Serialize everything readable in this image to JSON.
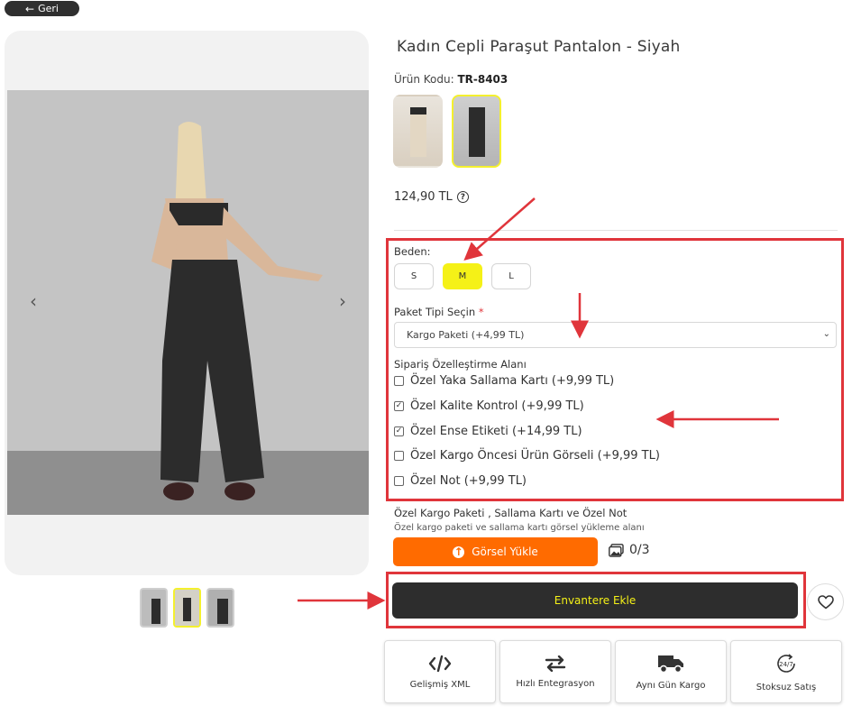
{
  "nav": {
    "back_label": "Geri"
  },
  "product": {
    "title": "Kadın Cepli Paraşut Pantalon - Siyah",
    "code_label": "Ürün Kodu:",
    "code_value": "TR-8403",
    "price": "124,90 TL"
  },
  "size": {
    "label": "Beden:",
    "options": [
      "S",
      "M",
      "L"
    ],
    "selected": "M"
  },
  "package": {
    "label": "Paket Tipi Seçin",
    "required_mark": "*",
    "selected": "Kargo Paketi (+4,99 TL)"
  },
  "customization": {
    "label": "Sipariş Özelleştirme Alanı",
    "options": [
      {
        "label": "Özel Yaka Sallama Kartı (+9,99 TL)",
        "checked": false
      },
      {
        "label": "Özel Kalite Kontrol (+9,99 TL)",
        "checked": true
      },
      {
        "label": "Özel Ense Etiketi (+14,99 TL)",
        "checked": true
      },
      {
        "label": "Özel Kargo Öncesi Ürün Görseli (+9,99 TL)",
        "checked": false
      },
      {
        "label": "Özel Not (+9,99 TL)",
        "checked": false
      }
    ]
  },
  "upload": {
    "title": "Özel Kargo Paketi , Sallama Kartı ve Özel Not",
    "subtitle": "Özel kargo paketi ve sallama kartı görsel yükleme alanı",
    "button_label": "Görsel Yükle",
    "count": "0/3"
  },
  "cart": {
    "button_label": "Envantere Ekle"
  },
  "features": [
    {
      "label": "Gelişmiş XML",
      "icon": "code-icon"
    },
    {
      "label": "Hızlı Entegrasyon",
      "icon": "swap-arrows-icon"
    },
    {
      "label": "Aynı Gün Kargo",
      "icon": "truck-icon"
    },
    {
      "label": "Stoksuz Satış",
      "icon": "24-7-icon"
    }
  ],
  "colors": {
    "accent_yellow": "#f5f117",
    "orange": "#ff6b00",
    "dark": "#2d2d2d",
    "annotation_red": "#e0353b"
  }
}
